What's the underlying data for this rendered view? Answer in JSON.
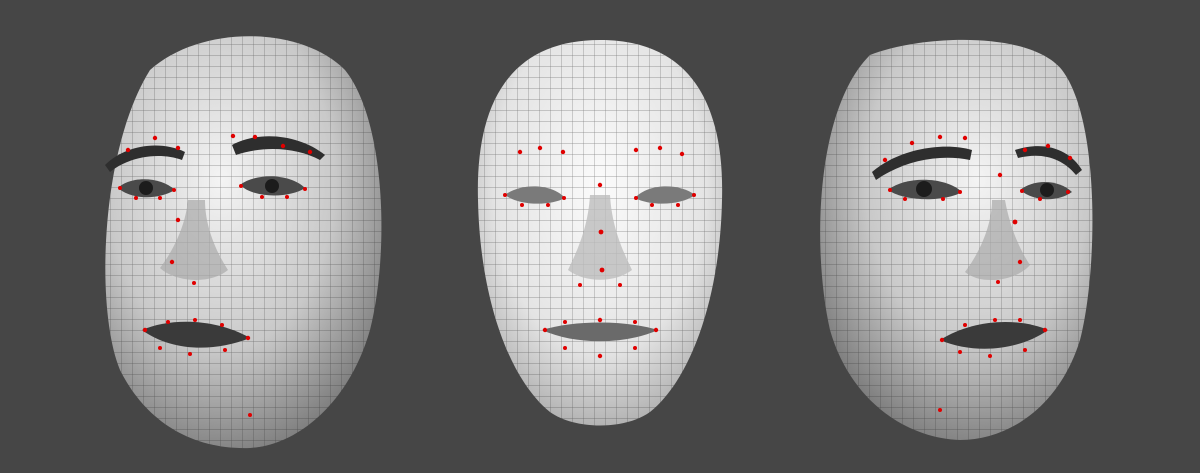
{
  "scene": {
    "background": "#464646",
    "mesh_shade_light": "#f1f1f1",
    "mesh_shade_dark": "#6f6f6f",
    "wire_color": "#222222",
    "landmark_color": "#e00000",
    "feature_color": "#2b2b2b"
  },
  "faces": [
    {
      "id": "face-left",
      "view": "three-quarter-left",
      "textured": true
    },
    {
      "id": "face-center",
      "view": "front",
      "textured": false
    },
    {
      "id": "face-right",
      "view": "three-quarter-right",
      "textured": true
    }
  ]
}
